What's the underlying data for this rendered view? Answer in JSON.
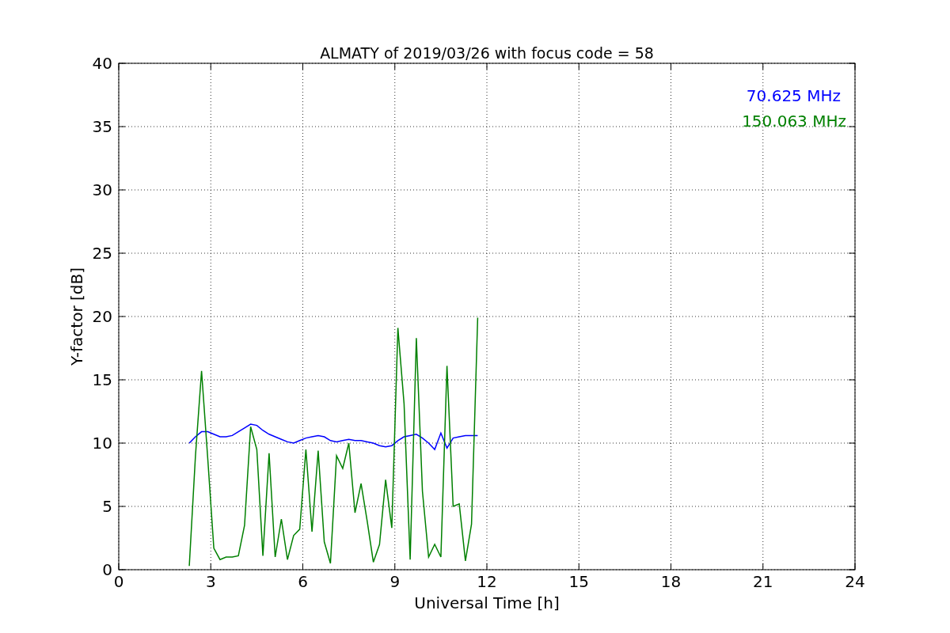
{
  "chart_data": {
    "type": "line",
    "title": "ALMATY of 2019/03/26 with focus code = 58",
    "xlabel": "Universal Time [h]",
    "ylabel": "Y-factor [dB]",
    "x": [
      2.3,
      2.5,
      2.7,
      2.9,
      3.1,
      3.3,
      3.5,
      3.7,
      3.9,
      4.1,
      4.3,
      4.5,
      4.7,
      4.9,
      5.1,
      5.3,
      5.5,
      5.7,
      5.9,
      6.1,
      6.3,
      6.5,
      6.7,
      6.9,
      7.1,
      7.3,
      7.5,
      7.7,
      7.9,
      8.1,
      8.3,
      8.5,
      8.7,
      8.9,
      9.1,
      9.3,
      9.5,
      9.7,
      9.9,
      10.1,
      10.3,
      10.5,
      10.7,
      10.9,
      11.1,
      11.3,
      11.5,
      11.7
    ],
    "series": [
      {
        "name": "70.625 MHz",
        "color": "#0000ff",
        "values": [
          10.0,
          10.5,
          10.9,
          10.9,
          10.7,
          10.5,
          10.5,
          10.6,
          10.9,
          11.2,
          11.5,
          11.4,
          11.0,
          10.7,
          10.5,
          10.3,
          10.1,
          10.0,
          10.2,
          10.4,
          10.5,
          10.6,
          10.5,
          10.2,
          10.1,
          10.2,
          10.3,
          10.2,
          10.2,
          10.1,
          10.0,
          9.8,
          9.7,
          9.8,
          10.2,
          10.5,
          10.6,
          10.7,
          10.4,
          10.0,
          9.5,
          10.8,
          9.6,
          10.4,
          10.5,
          10.6,
          10.6,
          10.6
        ]
      },
      {
        "name": "150.063 MHz",
        "color": "#008000",
        "values": [
          0.3,
          9.0,
          15.7,
          8.8,
          1.7,
          0.8,
          1.0,
          1.0,
          1.1,
          3.5,
          11.3,
          9.5,
          1.1,
          9.2,
          1.0,
          4.0,
          0.8,
          2.7,
          3.2,
          9.5,
          3.0,
          9.4,
          2.2,
          0.5,
          9.0,
          8.0,
          10.0,
          4.5,
          6.8,
          3.8,
          0.6,
          2.0,
          7.1,
          3.3,
          19.1,
          13.1,
          0.8,
          18.3,
          6.2,
          1.0,
          2.0,
          1.0,
          16.1,
          5.0,
          5.2,
          0.7,
          3.6,
          19.9
        ]
      }
    ],
    "xlim": [
      0,
      24
    ],
    "ylim": [
      0,
      40
    ],
    "xticks": [
      0,
      3,
      6,
      9,
      12,
      15,
      18,
      21,
      24
    ],
    "yticks": [
      0,
      5,
      10,
      15,
      20,
      25,
      30,
      35,
      40
    ],
    "grid": true
  }
}
